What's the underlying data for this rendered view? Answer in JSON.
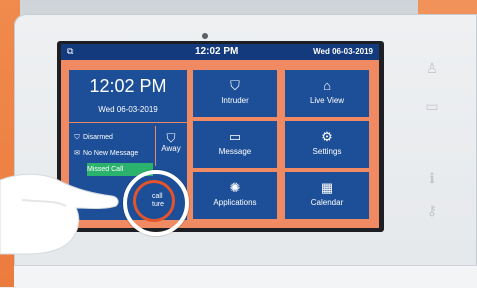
{
  "statusbar": {
    "time": "12:02 PM",
    "date": "Wed  06-03-2019"
  },
  "clock": {
    "time": "12:02 PM",
    "date": "Wed 06-03-2019"
  },
  "status": {
    "disarmed": "Disarmed",
    "no_new_message": "No New Message",
    "missed_call": "Missed Call"
  },
  "away_label": "Away",
  "record_label": "call\nture",
  "tiles": [
    {
      "label": "Intruder",
      "icon": "shield-icon"
    },
    {
      "label": "Live View",
      "icon": "camera-icon"
    },
    {
      "label": "Message",
      "icon": "message-icon"
    },
    {
      "label": "Settings",
      "icon": "gear-icon"
    },
    {
      "label": "Applications",
      "icon": "bulb-icon"
    },
    {
      "label": "Calendar",
      "icon": "calendar-icon"
    }
  ],
  "colors": {
    "screen_blue": "#1d4f98",
    "status_bar": "#123a7c",
    "accent_orange": "#f08a62",
    "missed_green": "#2bb36e"
  }
}
